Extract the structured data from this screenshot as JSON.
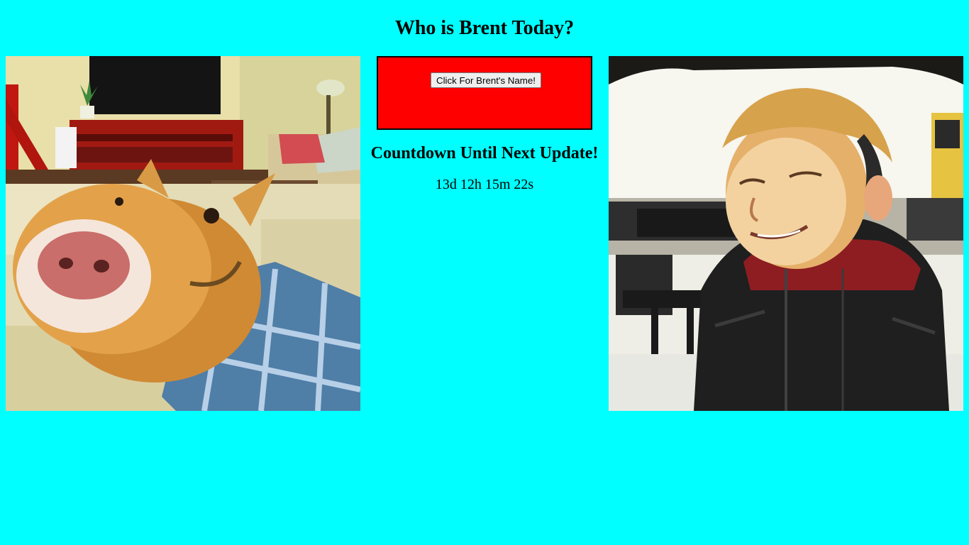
{
  "page": {
    "title": "Who is Brent Today?",
    "background_color": "#00ffff"
  },
  "name_panel": {
    "button_label": "Click For Brent's Name!",
    "panel_color": "#ff0000"
  },
  "countdown": {
    "heading": "Countdown Until Next Update!",
    "value": "13d 12h 15m 22s"
  },
  "images": {
    "left_icon": "dog-photo-icon",
    "right_icon": "boy-photo-icon"
  }
}
